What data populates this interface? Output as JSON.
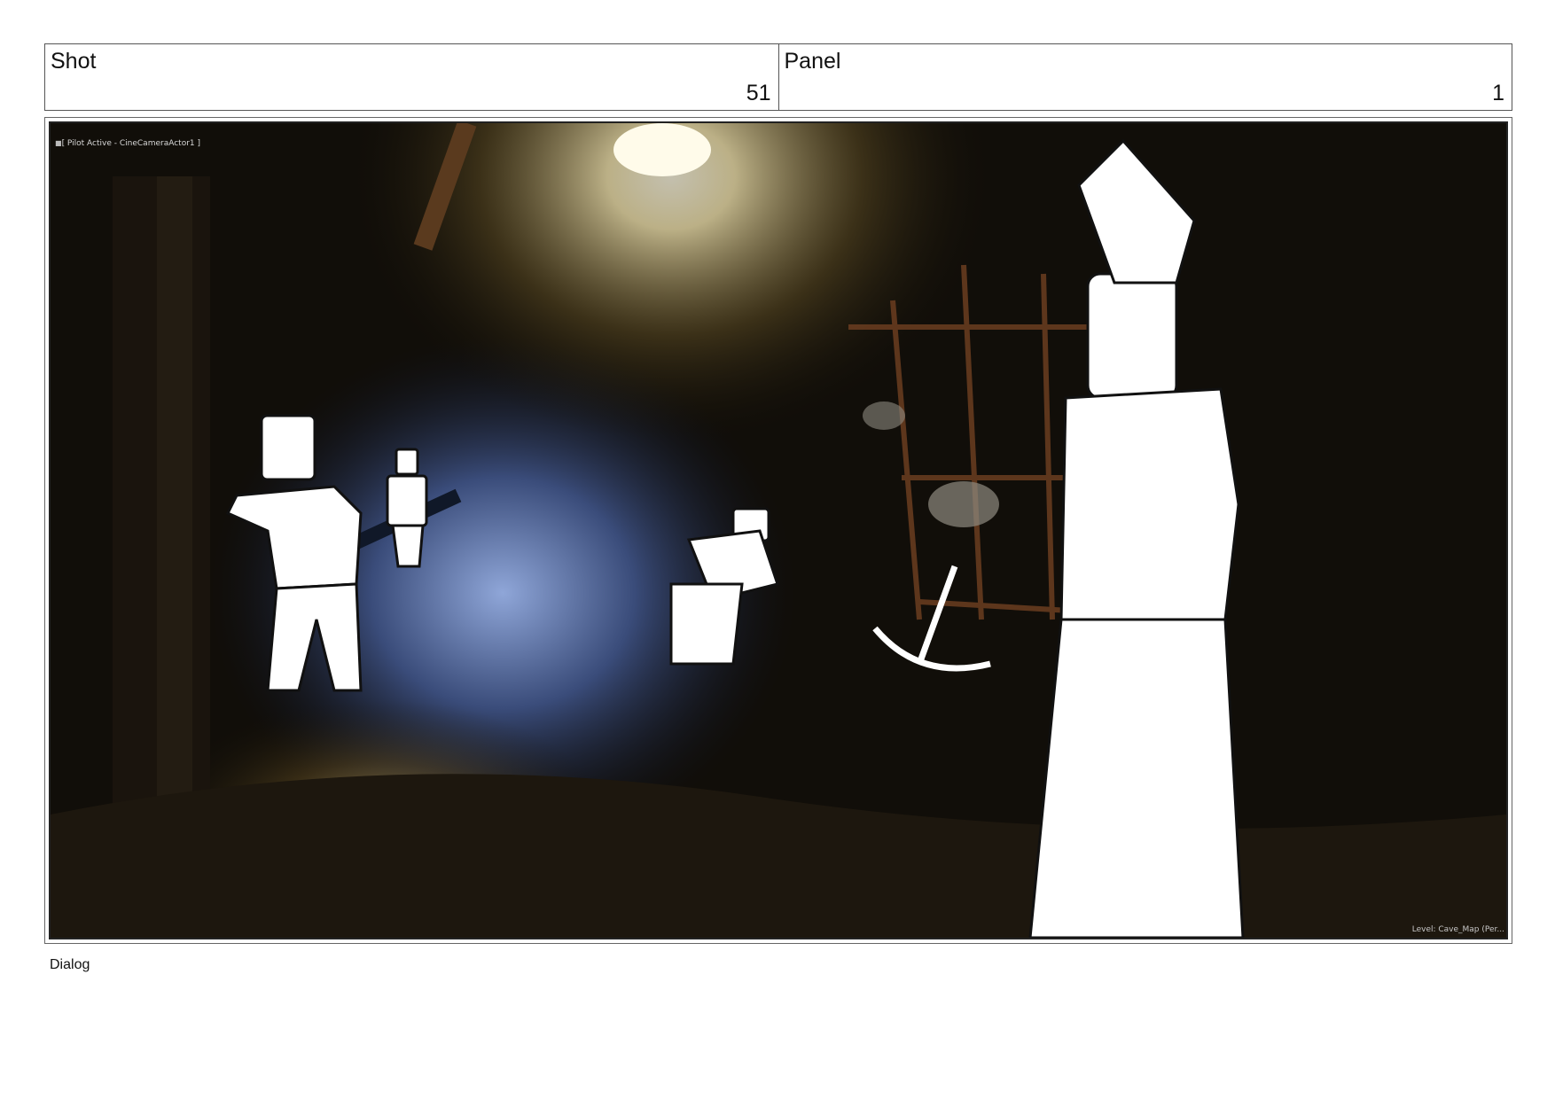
{
  "header": {
    "shot_label": "Shot",
    "shot_number": "51",
    "panel_label": "Panel",
    "panel_number": "1"
  },
  "viewport": {
    "pilot_status": "[ Pilot Active - CineCameraActor1 ]",
    "level_label": "Level:  Cave_Map (Per..."
  },
  "dialog": {
    "label": "Dialog"
  },
  "colors": {
    "border": "#555555",
    "scene_dark": "#0b0906",
    "tunnel_blue": "#3a4c7a",
    "lamp_glow": "#f4e6b0",
    "sketch_white": "#ffffff"
  }
}
